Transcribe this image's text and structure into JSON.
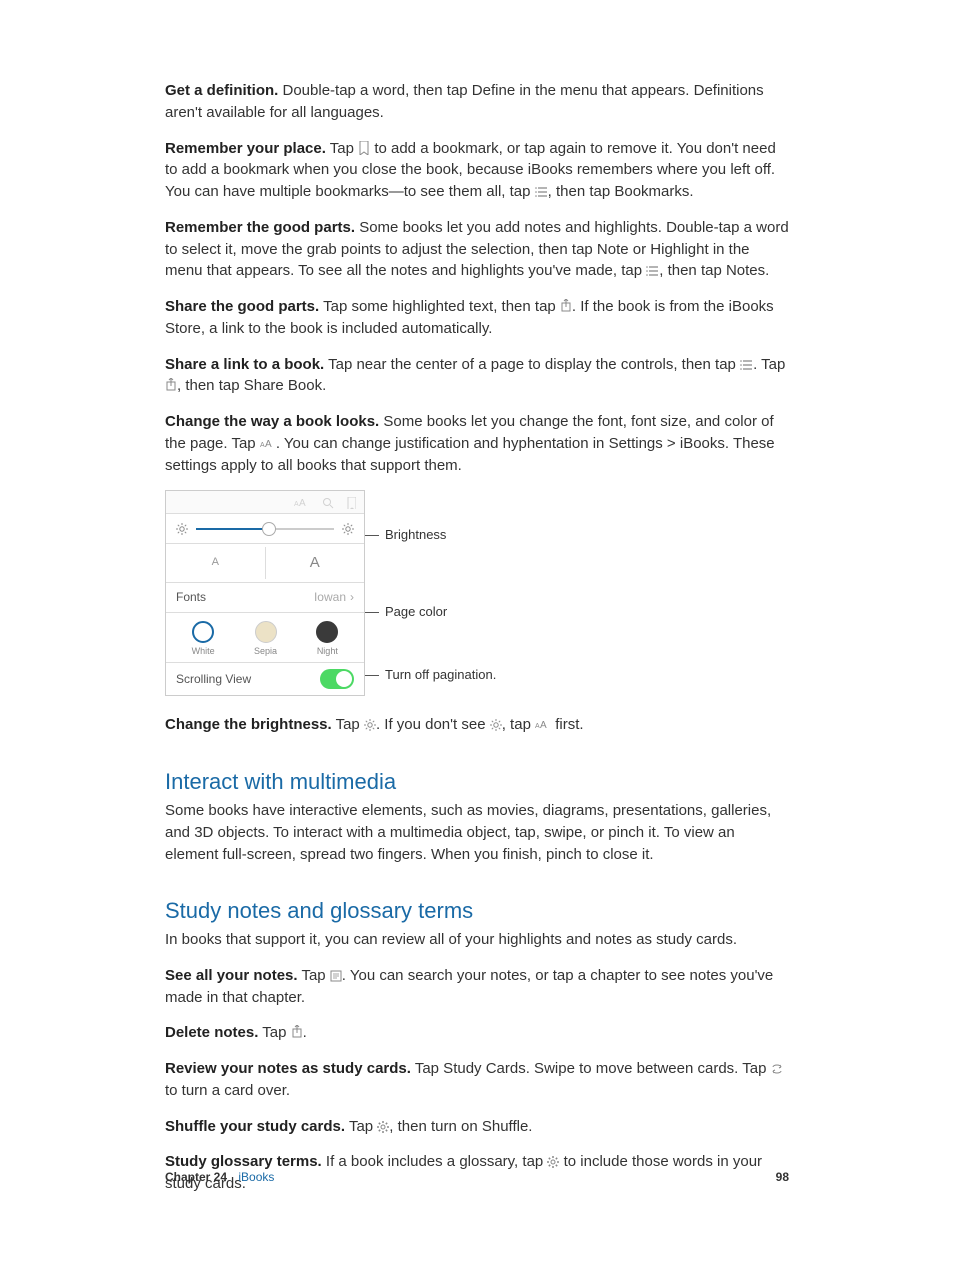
{
  "paragraphs": {
    "p1_bold": "Get a definition.",
    "p1_text": " Double-tap a word, then tap Define in the menu that appears. Definitions aren't available for all languages.",
    "p2_bold": "Remember your place.",
    "p2_a": " Tap ",
    "p2_b": " to add a bookmark, or tap again to remove it. You don't need to add a bookmark when you close the book, because iBooks remembers where you left off. You can have multiple bookmarks—to see them all, tap ",
    "p2_c": ", then tap Bookmarks.",
    "p3_bold": "Remember the good parts.",
    "p3_a": " Some books let you add notes and highlights. Double-tap a word to select it, move the grab points to adjust the selection, then tap Note or Highlight in the menu that appears. To see all the notes and highlights you've made, tap ",
    "p3_b": ", then tap Notes.",
    "p4_bold": "Share the good parts.",
    "p4_a": " Tap some highlighted text, then tap ",
    "p4_b": ". If the book is from the iBooks Store, a link to the book is included automatically.",
    "p5_bold": "Share a link to a book.",
    "p5_a": " Tap near the center of a page to display the controls, then tap ",
    "p5_b": ". Tap ",
    "p5_c": ", then tap Share Book.",
    "p6_bold": "Change the way a book looks.",
    "p6_a": " Some books let you change the font, font size, and color of the page. Tap ",
    "p6_b": ". You can change justification and hyphentation in Settings > iBooks. These settings apply to all books that support them.",
    "p7_bold": "Change the brightness.",
    "p7_a": " Tap ",
    "p7_b": ". If you don't see ",
    "p7_c": ", tap ",
    "p7_d": " first."
  },
  "sections": {
    "multimedia_title": "Interact with multimedia",
    "multimedia_text": "Some books have interactive elements, such as movies, diagrams, presentations, galleries, and 3D objects. To interact with a multimedia object, tap, swipe, or pinch it. To view an element full-screen, spread two fingers. When you finish, pinch to close it.",
    "study_title": "Study notes and glossary terms",
    "study_intro": "In books that support it, you can review all of your highlights and notes as study cards.",
    "s1_bold": "See all your notes.",
    "s1_a": " Tap ",
    "s1_b": ". You can search your notes, or tap a chapter to see notes you've made in that chapter.",
    "s2_bold": "Delete notes.",
    "s2_a": " Tap ",
    "s2_b": ".",
    "s3_bold": "Review your notes as study cards.",
    "s3_a": " Tap Study Cards. Swipe to move between cards. Tap ",
    "s3_b": " to turn a card over.",
    "s4_bold": "Shuffle your study cards.",
    "s4_a": " Tap ",
    "s4_b": ", then turn on Shuffle.",
    "s5_bold": "Study glossary terms.",
    "s5_a": " If a book includes a glossary, tap ",
    "s5_b": " to include those words in your study cards."
  },
  "panel": {
    "small_a": "A",
    "large_a": "A",
    "fonts_label": "Fonts",
    "font_name": "Iowan",
    "color_white": "White",
    "color_sepia": "Sepia",
    "color_night": "Night",
    "scroll_label": "Scrolling View"
  },
  "callouts": {
    "brightness": "Brightness",
    "page_color": "Page color",
    "pagination": "Turn off pagination."
  },
  "footer": {
    "chapter_label": "Chapter  24",
    "chapter_name": "iBooks",
    "page": "98"
  }
}
